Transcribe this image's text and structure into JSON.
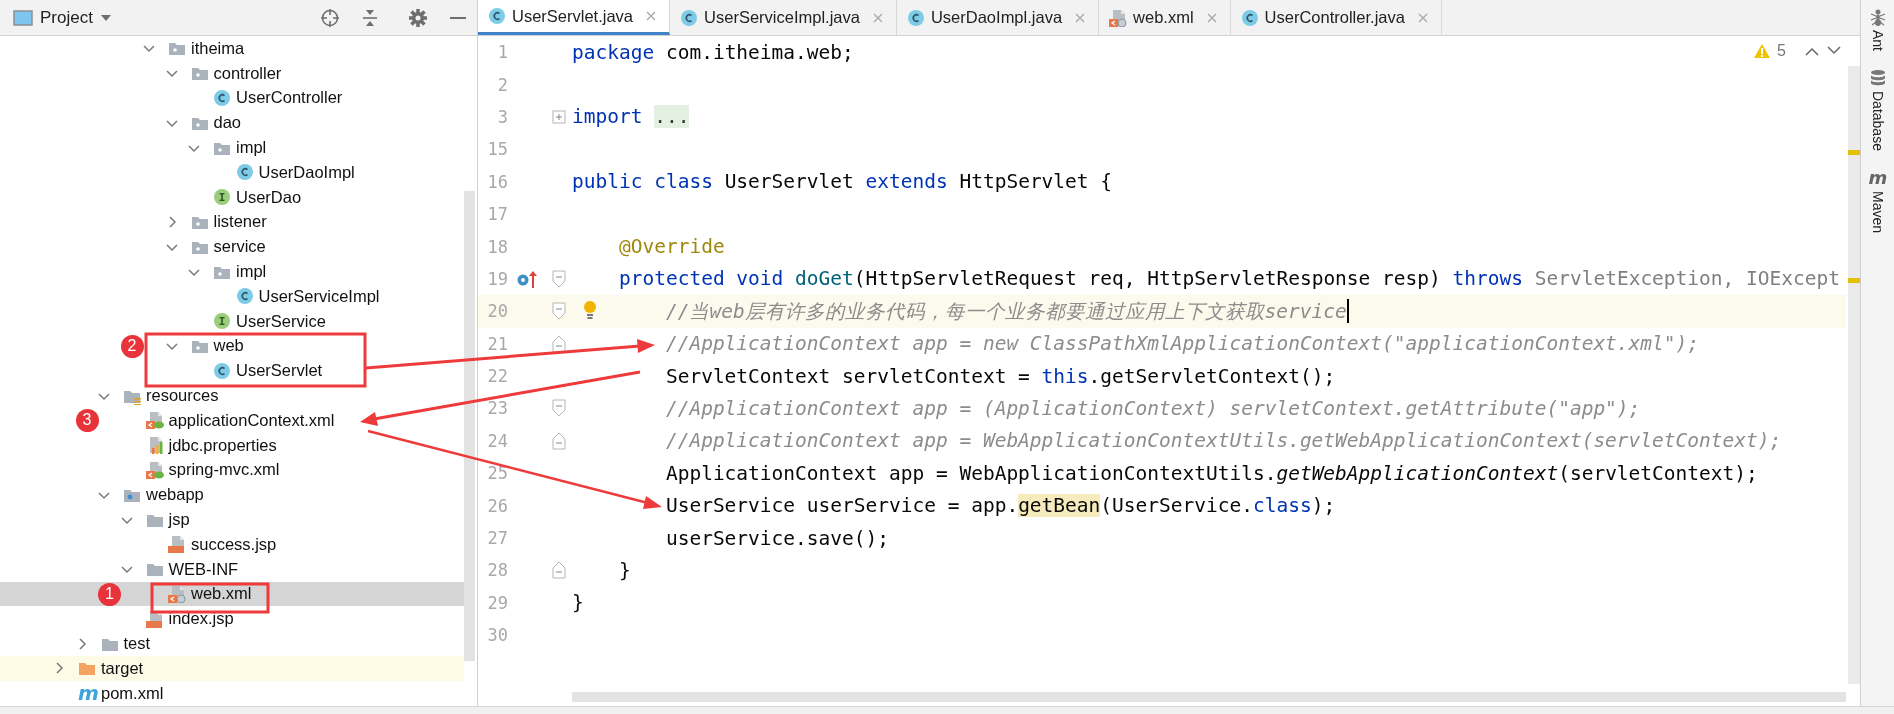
{
  "project_panel": {
    "title": "Project",
    "tree": [
      {
        "children": [
          {
            "children": [
              {
                "children": [
                  {
                    "children": [
                      {
                        "label": "itheima",
                        "kind": "package",
                        "expanded": true,
                        "selected": false,
                        "children": [
                          {
                            "label": "controller",
                            "kind": "package",
                            "expanded": true,
                            "selected": false,
                            "children": [
                              {
                                "label": "UserController",
                                "kind": "class",
                                "selected": false
                              }
                            ]
                          },
                          {
                            "label": "dao",
                            "kind": "package",
                            "expanded": true,
                            "selected": false,
                            "children": [
                              {
                                "label": "impl",
                                "kind": "package",
                                "expanded": true,
                                "selected": false,
                                "children": [
                                  {
                                    "label": "UserDaoImpl",
                                    "kind": "class",
                                    "selected": false
                                  }
                                ]
                              },
                              {
                                "label": "UserDao",
                                "kind": "interface",
                                "selected": false
                              }
                            ]
                          },
                          {
                            "label": "listener",
                            "kind": "package",
                            "expanded": false,
                            "selected": false
                          },
                          {
                            "label": "service",
                            "kind": "package",
                            "expanded": true,
                            "selected": false,
                            "children": [
                              {
                                "label": "impl",
                                "kind": "package",
                                "expanded": true,
                                "selected": false,
                                "children": [
                                  {
                                    "label": "UserServiceImpl",
                                    "kind": "class",
                                    "selected": false
                                  }
                                ]
                              },
                              {
                                "label": "UserService",
                                "kind": "interface",
                                "selected": false
                              }
                            ]
                          },
                          {
                            "label": "web",
                            "kind": "package",
                            "expanded": true,
                            "selected": false,
                            "callout": "2",
                            "children": [
                              {
                                "label": "UserServlet",
                                "kind": "class",
                                "selected": false
                              }
                            ]
                          }
                        ]
                      }
                    ]
                  }
                ]
              },
              {
                "label": "resources",
                "kind": "resources",
                "expanded": true,
                "selected": false,
                "children": [
                  {
                    "label": "applicationContext.xml",
                    "kind": "spring-xml",
                    "selected": false,
                    "callout": "3"
                  },
                  {
                    "label": "jdbc.properties",
                    "kind": "properties",
                    "selected": false
                  },
                  {
                    "label": "spring-mvc.xml",
                    "kind": "spring-xml",
                    "selected": false
                  }
                ]
              },
              {
                "label": "webapp",
                "kind": "web-folder",
                "expanded": true,
                "selected": false,
                "children": [
                  {
                    "label": "jsp",
                    "kind": "folder",
                    "expanded": true,
                    "selected": false,
                    "children": [
                      {
                        "label": "success.jsp",
                        "kind": "jsp",
                        "selected": false
                      }
                    ]
                  },
                  {
                    "label": "WEB-INF",
                    "kind": "folder",
                    "expanded": true,
                    "selected": false,
                    "children": [
                      {
                        "label": "web.xml",
                        "kind": "web-xml",
                        "selected": true,
                        "callout": "1"
                      }
                    ]
                  },
                  {
                    "label": "index.jsp",
                    "kind": "jsp",
                    "selected": false
                  }
                ]
              }
            ]
          },
          {
            "label": "test",
            "kind": "folder",
            "expanded": false,
            "selected": false
          }
        ]
      },
      {
        "label": "target",
        "kind": "excluded",
        "expanded": false,
        "selected": false
      },
      {
        "label": "pom.xml",
        "kind": "maven",
        "icon_text": "m",
        "selected": false
      }
    ]
  },
  "editor": {
    "tabs": [
      {
        "label": "UserServlet.java",
        "kind": "class",
        "selected": true
      },
      {
        "label": "UserServiceImpl.java",
        "kind": "class",
        "selected": false
      },
      {
        "label": "UserDaoImpl.java",
        "kind": "class",
        "selected": false
      },
      {
        "label": "web.xml",
        "kind": "web-xml",
        "selected": false
      },
      {
        "label": "UserController.java",
        "kind": "class",
        "selected": false
      }
    ],
    "warnings": "5",
    "lines": [
      {
        "number": "1",
        "current": false,
        "tokens": [
          {
            "kind": "keyword",
            "text": "package"
          },
          {
            "kind": "plain",
            "text": " com.itheima.web;"
          }
        ]
      },
      {
        "number": "2",
        "current": false
      },
      {
        "number": "3",
        "current": false,
        "gutter": [
          {
            "kind": "fold-collapsed"
          }
        ],
        "tokens": [
          {
            "kind": "keyword",
            "text": "import "
          },
          {
            "kind": "folded",
            "text": "..."
          }
        ]
      },
      {
        "number": "15",
        "current": false
      },
      {
        "number": "16",
        "current": false,
        "tokens": [
          {
            "kind": "keyword",
            "text": "public class"
          },
          {
            "kind": "plain",
            "text": " UserServlet "
          },
          {
            "kind": "keyword",
            "text": "extends"
          },
          {
            "kind": "plain",
            "text": " HttpServlet {"
          }
        ]
      },
      {
        "number": "17",
        "current": false
      },
      {
        "number": "18",
        "current": false,
        "tokens": [
          {
            "kind": "annotation",
            "text": "    @Override"
          }
        ]
      },
      {
        "number": "19",
        "current": false,
        "gutter": [
          {
            "kind": "override"
          },
          {
            "kind": "fold-start"
          }
        ],
        "tokens": [
          {
            "kind": "keyword",
            "text": "    protected void "
          },
          {
            "kind": "declaration",
            "text": "doGet"
          },
          {
            "kind": "plain",
            "text": "(HttpServletRequest req, HttpServletResponse resp) "
          },
          {
            "kind": "keyword",
            "text": "throws "
          },
          {
            "kind": "unused",
            "text": "ServletException, IOExcept"
          }
        ]
      },
      {
        "number": "20",
        "current": true,
        "gutter": [
          {
            "kind": "fold-start"
          },
          {
            "kind": "bulb"
          }
        ],
        "tokens": [
          {
            "kind": "comment",
            "text": "        //当web层有许多的业务代码，每一个业务都要通过应用上下文获取service"
          }
        ]
      },
      {
        "number": "21",
        "current": false,
        "gutter": [
          {
            "kind": "fold-end"
          }
        ],
        "tokens": [
          {
            "kind": "comment",
            "text": "        //ApplicationContext app = new ClassPathXmlApplicationContext(\"applicationContext.xml\");"
          }
        ]
      },
      {
        "number": "22",
        "current": false,
        "tokens": [
          {
            "kind": "plain",
            "text": "        ServletContext servletContext = "
          },
          {
            "kind": "keyword",
            "text": "this"
          },
          {
            "kind": "plain",
            "text": ".getServletContext();"
          }
        ]
      },
      {
        "number": "23",
        "current": false,
        "gutter": [
          {
            "kind": "fold-start"
          }
        ],
        "tokens": [
          {
            "kind": "comment",
            "text": "        //ApplicationContext app = (ApplicationContext) servletContext.getAttribute(\"app\");"
          }
        ]
      },
      {
        "number": "24",
        "current": false,
        "gutter": [
          {
            "kind": "fold-end"
          }
        ],
        "tokens": [
          {
            "kind": "comment",
            "text": "        //ApplicationContext app = WebApplicationContextUtils.getWebApplicationContext(servletContext);"
          }
        ]
      },
      {
        "number": "25",
        "current": false,
        "tokens": [
          {
            "kind": "plain",
            "text": "        ApplicationContext app = WebApplicationContextUtils."
          },
          {
            "kind": "static",
            "text": "getWebApplicationContext"
          },
          {
            "kind": "plain",
            "text": "(servletContext);"
          }
        ]
      },
      {
        "number": "26",
        "current": false,
        "tokens": [
          {
            "kind": "plain",
            "text": "        UserService userService = app."
          },
          {
            "kind": "highlight",
            "text": "getBean"
          },
          {
            "kind": "plain",
            "text": "(UserService."
          },
          {
            "kind": "keyword",
            "text": "class"
          },
          {
            "kind": "plain",
            "text": ");"
          }
        ]
      },
      {
        "number": "27",
        "current": false,
        "tokens": [
          {
            "kind": "plain",
            "text": "        userService.save();"
          }
        ]
      },
      {
        "number": "28",
        "current": false,
        "gutter": [
          {
            "kind": "fold-end"
          }
        ],
        "tokens": [
          {
            "kind": "plain",
            "text": "    }"
          }
        ]
      },
      {
        "number": "29",
        "current": false,
        "tokens": [
          {
            "kind": "plain",
            "text": "}"
          }
        ]
      },
      {
        "number": "30",
        "current": false
      }
    ]
  },
  "tool_strip": [
    {
      "label": "Ant",
      "kind": "ant"
    },
    {
      "label": "Database",
      "kind": "database"
    },
    {
      "label": "Maven",
      "kind": "maven",
      "icon_text": "m"
    }
  ]
}
